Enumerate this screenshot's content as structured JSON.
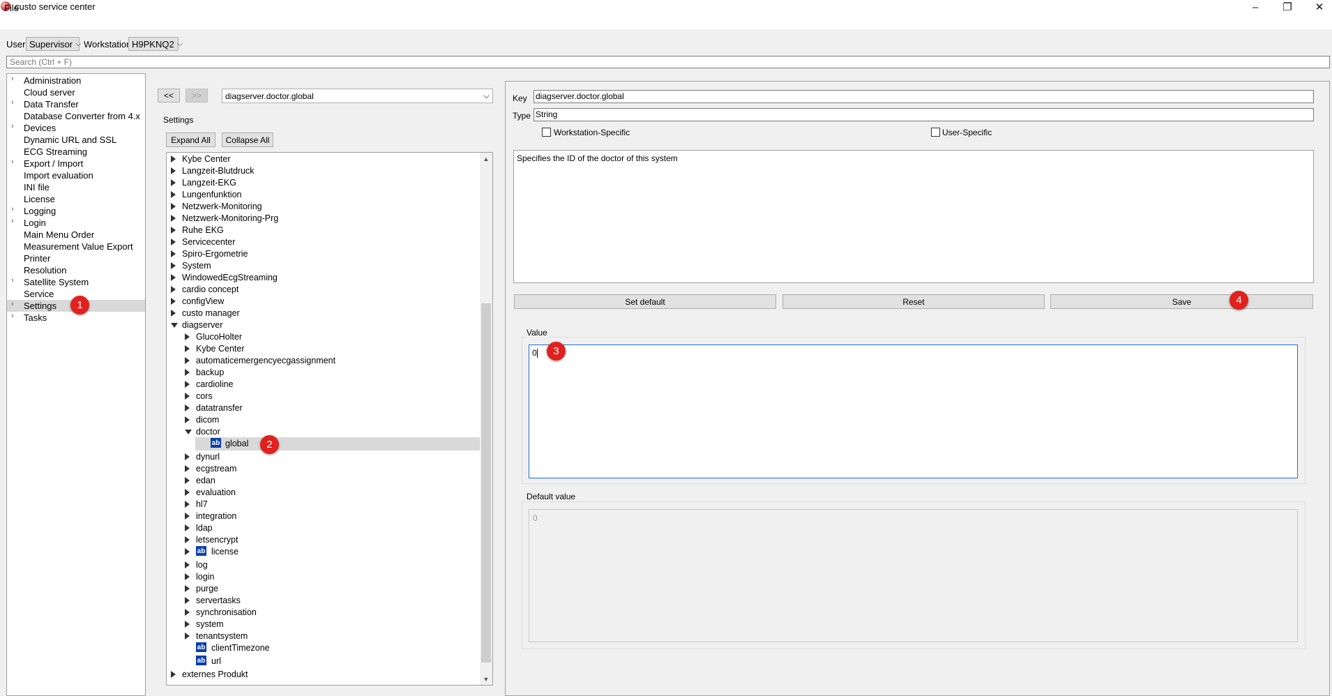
{
  "window": {
    "title": "custo service center",
    "controls": {
      "minimize": "–",
      "restore": "❐",
      "close": "✕"
    }
  },
  "menu": {
    "file": "File"
  },
  "toolbar": {
    "user_label": "User",
    "user_value": "Supervisor",
    "workstation_label": "Workstation",
    "workstation_value": "H9PKNQ2"
  },
  "search": {
    "placeholder": "Search (Ctrl + F)"
  },
  "sidebar": {
    "items": [
      {
        "label": "Administration",
        "expandable": true
      },
      {
        "label": "Cloud server",
        "expandable": false
      },
      {
        "label": "Data Transfer",
        "expandable": true
      },
      {
        "label": "Database Converter from 4.x",
        "expandable": false
      },
      {
        "label": "Devices",
        "expandable": true
      },
      {
        "label": "Dynamic URL and SSL",
        "expandable": false
      },
      {
        "label": "ECG Streaming",
        "expandable": false
      },
      {
        "label": "Export / Import",
        "expandable": true
      },
      {
        "label": "Import evaluation",
        "expandable": false
      },
      {
        "label": "INI file",
        "expandable": false
      },
      {
        "label": "License",
        "expandable": false
      },
      {
        "label": "Logging",
        "expandable": true
      },
      {
        "label": "Login",
        "expandable": true
      },
      {
        "label": "Main Menu Order",
        "expandable": false
      },
      {
        "label": "Measurement Value Export",
        "expandable": false
      },
      {
        "label": "Printer",
        "expandable": false
      },
      {
        "label": "Resolution",
        "expandable": false
      },
      {
        "label": "Satellite System",
        "expandable": true
      },
      {
        "label": "Service",
        "expandable": false
      },
      {
        "label": "Settings",
        "expandable": true,
        "selected": true
      },
      {
        "label": "Tasks",
        "expandable": true
      }
    ]
  },
  "middle": {
    "back_label": "<<",
    "forward_label": ">>",
    "path_value": "diagserver.doctor.global",
    "settings_label": "Settings",
    "expand_all": "Expand All",
    "collapse_all": "Collapse All",
    "tree": [
      {
        "label": "Kybe Center",
        "level": 0,
        "kind": "closed"
      },
      {
        "label": "Langzeit-Blutdruck",
        "level": 0,
        "kind": "closed"
      },
      {
        "label": "Langzeit-EKG",
        "level": 0,
        "kind": "closed"
      },
      {
        "label": "Lungenfunktion",
        "level": 0,
        "kind": "closed"
      },
      {
        "label": "Netzwerk-Monitoring",
        "level": 0,
        "kind": "closed"
      },
      {
        "label": "Netzwerk-Monitoring-Prg",
        "level": 0,
        "kind": "closed"
      },
      {
        "label": "Ruhe EKG",
        "level": 0,
        "kind": "closed"
      },
      {
        "label": "Servicecenter",
        "level": 0,
        "kind": "closed"
      },
      {
        "label": "Spiro-Ergometrie",
        "level": 0,
        "kind": "closed"
      },
      {
        "label": "System",
        "level": 0,
        "kind": "closed"
      },
      {
        "label": "WindowedEcgStreaming",
        "level": 0,
        "kind": "closed"
      },
      {
        "label": "cardio concept",
        "level": 0,
        "kind": "closed"
      },
      {
        "label": "configView",
        "level": 0,
        "kind": "closed"
      },
      {
        "label": "custo manager",
        "level": 0,
        "kind": "closed"
      },
      {
        "label": "diagserver",
        "level": 0,
        "kind": "open"
      },
      {
        "label": "GlucoHolter",
        "level": 1,
        "kind": "closed"
      },
      {
        "label": "Kybe Center",
        "level": 1,
        "kind": "closed"
      },
      {
        "label": "automaticemergencyecgassignment",
        "level": 1,
        "kind": "closed"
      },
      {
        "label": "backup",
        "level": 1,
        "kind": "closed"
      },
      {
        "label": "cardioline",
        "level": 1,
        "kind": "closed"
      },
      {
        "label": "cors",
        "level": 1,
        "kind": "closed"
      },
      {
        "label": "datatransfer",
        "level": 1,
        "kind": "closed"
      },
      {
        "label": "dicom",
        "level": 1,
        "kind": "closed"
      },
      {
        "label": "doctor",
        "level": 1,
        "kind": "open"
      },
      {
        "label": "global",
        "level": 2,
        "kind": "leaf",
        "selected": true
      },
      {
        "label": "dynurl",
        "level": 1,
        "kind": "closed"
      },
      {
        "label": "ecgstream",
        "level": 1,
        "kind": "closed"
      },
      {
        "label": "edan",
        "level": 1,
        "kind": "closed"
      },
      {
        "label": "evaluation",
        "level": 1,
        "kind": "closed"
      },
      {
        "label": "hl7",
        "level": 1,
        "kind": "closed"
      },
      {
        "label": "integration",
        "level": 1,
        "kind": "closed"
      },
      {
        "label": "ldap",
        "level": 1,
        "kind": "closed"
      },
      {
        "label": "letsencrypt",
        "level": 1,
        "kind": "closed"
      },
      {
        "label": "license",
        "level": 1,
        "kind": "closed-leaf"
      },
      {
        "label": "log",
        "level": 1,
        "kind": "closed"
      },
      {
        "label": "login",
        "level": 1,
        "kind": "closed"
      },
      {
        "label": "purge",
        "level": 1,
        "kind": "closed"
      },
      {
        "label": "servertasks",
        "level": 1,
        "kind": "closed"
      },
      {
        "label": "synchronisation",
        "level": 1,
        "kind": "closed"
      },
      {
        "label": "system",
        "level": 1,
        "kind": "closed"
      },
      {
        "label": "tenantsystem",
        "level": 1,
        "kind": "closed"
      },
      {
        "label": "clientTimezone",
        "level": 1,
        "kind": "leaf"
      },
      {
        "label": "url",
        "level": 1,
        "kind": "leaf"
      },
      {
        "label": "externes Produkt",
        "level": 0,
        "kind": "closed"
      }
    ],
    "leaf_icon_text": "ab"
  },
  "detail": {
    "key_label": "Key",
    "key_value": "diagserver.doctor.global",
    "type_label": "Type",
    "type_value": "String",
    "workstation_specific": "Workstation-Specific",
    "user_specific": "User-Specific",
    "description": "Specifies the ID of the doctor of this system",
    "set_default": "Set default",
    "reset": "Reset",
    "save": "Save",
    "value_label": "Value",
    "value": "0",
    "default_label": "Default value",
    "default_value": "0"
  },
  "badges": [
    "1",
    "2",
    "3",
    "4"
  ]
}
